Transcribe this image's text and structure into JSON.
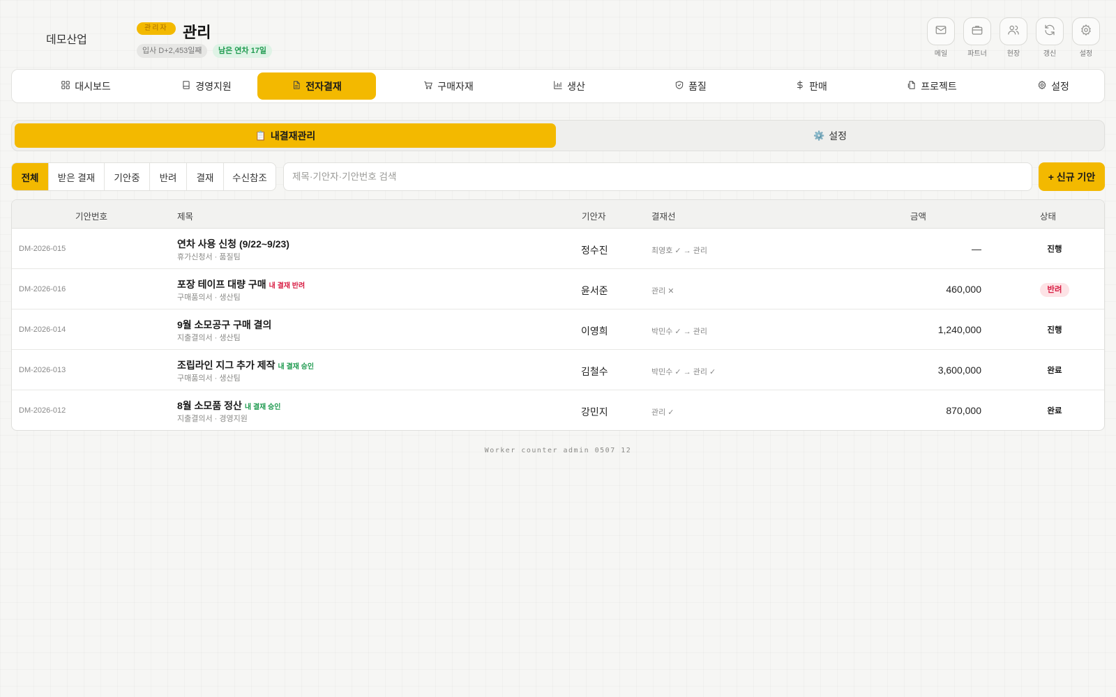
{
  "header": {
    "company": "데모산업",
    "role_badge": "관리자",
    "user_name": "관리",
    "tenure": "입사 D+2,453일째",
    "leave": "남은 연차 17일",
    "quick_actions": [
      {
        "label": "메일",
        "icon": "mail-icon"
      },
      {
        "label": "파트너",
        "icon": "briefcase-icon"
      },
      {
        "label": "현장",
        "icon": "users-icon"
      },
      {
        "label": "갱신",
        "icon": "refresh-icon"
      },
      {
        "label": "설정",
        "icon": "gear-icon"
      }
    ]
  },
  "nav": {
    "items": [
      {
        "label": "대시보드",
        "icon": "grid-icon"
      },
      {
        "label": "경영지원",
        "icon": "book-icon"
      },
      {
        "label": "전자결재",
        "icon": "document-icon",
        "active": true
      },
      {
        "label": "구매자재",
        "icon": "cart-icon"
      },
      {
        "label": "생산",
        "icon": "chart-icon"
      },
      {
        "label": "품질",
        "icon": "shield-icon"
      },
      {
        "label": "판매",
        "icon": "dollar-icon"
      },
      {
        "label": "프로젝트",
        "icon": "file-icon"
      },
      {
        "label": "설정",
        "icon": "gear-icon"
      }
    ]
  },
  "subtabs": [
    {
      "emoji": "📋",
      "label": "내결재관리",
      "active": true
    },
    {
      "emoji": "⚙️",
      "label": "설정"
    }
  ],
  "filters": [
    "전체",
    "받은 결재",
    "기안중",
    "반려",
    "결재",
    "수신참조"
  ],
  "active_filter": "전체",
  "search": {
    "placeholder": "제목·기안자·기안번호 검색",
    "value": ""
  },
  "new_button": "+ 신규 기안",
  "table": {
    "headers": {
      "id": "기안번호",
      "title": "제목",
      "drafter": "기안자",
      "line": "결재선",
      "amount": "금액",
      "status": "상태"
    },
    "rows": [
      {
        "id": "DM-2026-015",
        "title": "연차 사용 신청 (9/22~9/23)",
        "tag": "",
        "sub": "휴가신청서 · 품질팀",
        "drafter": "정수진",
        "line": "최영호 ✓ → 관리",
        "amount": "—",
        "status": "진행",
        "status_type": "progress"
      },
      {
        "id": "DM-2026-016",
        "title": "포장 테이프 대량 구매",
        "tag": "내 결재 반려",
        "tag_type": "reject",
        "sub": "구매품의서 · 생산팀",
        "drafter": "윤서준",
        "line": "관리 ✕",
        "amount": "460,000",
        "status": "반려",
        "status_type": "rejected"
      },
      {
        "id": "DM-2026-014",
        "title": "9월 소모공구 구매 결의",
        "tag": "",
        "sub": "지출결의서 · 생산팀",
        "drafter": "이영희",
        "line": "박민수 ✓ → 관리",
        "amount": "1,240,000",
        "status": "진행",
        "status_type": "progress"
      },
      {
        "id": "DM-2026-013",
        "title": "조립라인 지그 추가 제작",
        "tag": "내 결재 승인",
        "tag_type": "approve",
        "sub": "구매품의서 · 생산팀",
        "drafter": "김철수",
        "line": "박민수 ✓ → 관리 ✓",
        "amount": "3,600,000",
        "status": "완료",
        "status_type": "done"
      },
      {
        "id": "DM-2026-012",
        "title": "8월 소모품 정산",
        "tag": "내 결재 승인",
        "tag_type": "approve",
        "sub": "지출결의서 · 경영지원",
        "drafter": "강민지",
        "line": "관리 ✓",
        "amount": "870,000",
        "status": "완료",
        "status_type": "done"
      }
    ]
  },
  "footer": "Worker counter admin 0507 12",
  "colors": {
    "accent": "#f3b900",
    "reject": "#d81d43",
    "approve": "#1e9a4f",
    "background": "#f6f6f4"
  }
}
